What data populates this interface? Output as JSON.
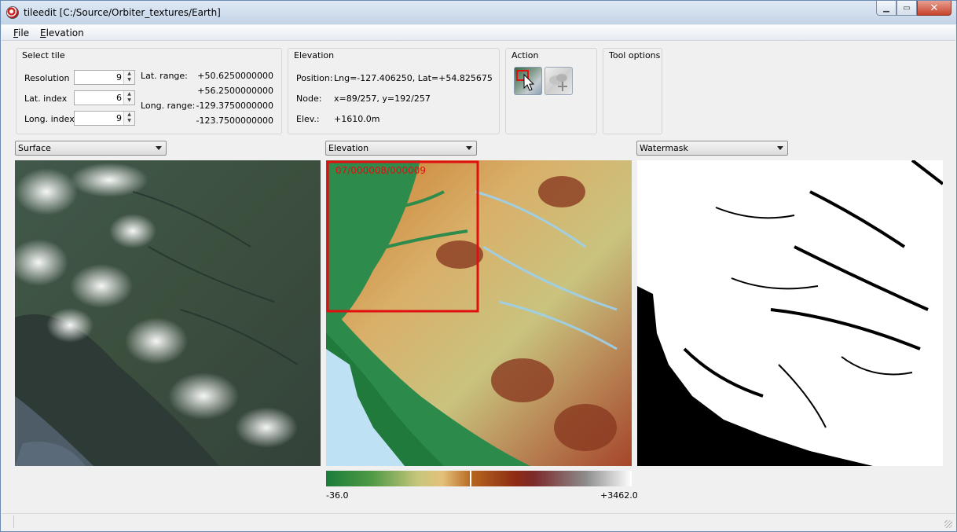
{
  "window": {
    "title": "tileedit [C:/Source/Orbiter_textures/Earth]",
    "minimize_glyph": "▁",
    "maximize_glyph": "▭",
    "close_glyph": "✕"
  },
  "menu": {
    "file_u": "F",
    "file_rest": "ile",
    "elevation_u": "E",
    "elevation_rest": "levation"
  },
  "select_tile": {
    "title": "Select tile",
    "resolution_label": "Resolution",
    "resolution_value": "9",
    "lat_index_label": "Lat. index",
    "lat_index_value": "6",
    "long_index_label": "Long. index",
    "long_index_value": "9",
    "lat_range_label": "Lat. range:",
    "lat_range_min": "+50.6250000000",
    "lat_range_max": "+56.2500000000",
    "long_range_label": "Long. range:",
    "long_range_min": "-129.3750000000",
    "long_range_max": "-123.7500000000"
  },
  "elevation_info": {
    "title": "Elevation",
    "position_label": "Position:",
    "position_value": "Lng=-127.406250, Lat=+54.825675",
    "node_label": "Node:",
    "node_value": "x=89/257, y=192/257",
    "elev_label": "Elev.:",
    "elev_value": "+1610.0m"
  },
  "action": {
    "title": "Action",
    "buttons": [
      "select-tile-action",
      "add-tile-action"
    ]
  },
  "tool_options": {
    "title": "Tool options"
  },
  "panels": {
    "left_layer": "Surface",
    "middle_layer": "Elevation",
    "right_layer": "Watermask"
  },
  "overlay_text": "07/000008/000009",
  "colorbar": {
    "min": "-36.0",
    "max": "+3462.0"
  },
  "colors": {
    "accent": "#3c7fb1",
    "selection_red": "#e01010",
    "water_blue": "#bde0f5"
  }
}
